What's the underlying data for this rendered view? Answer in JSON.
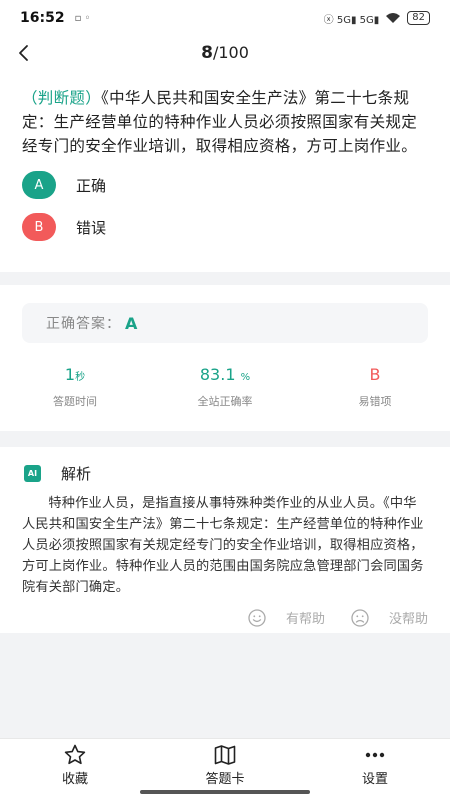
{
  "status_bar": {
    "time": "16:52",
    "notification": "▫ ◦",
    "signal_text": "ⓧ 5G▮ 5G▮",
    "battery": "82"
  },
  "header": {
    "current": "8",
    "total": "/100"
  },
  "question": {
    "type_label": "（判断题）",
    "text": "《中华人民共和国安全生产法》第二十七条规定：生产经营单位的特种作业人员必须按照国家有关规定经专门的安全作业培训，取得相应资格，方可上岗作业。",
    "options": [
      {
        "letter": "A",
        "text": "正确",
        "color": "#1aa389"
      },
      {
        "letter": "B",
        "text": "错误",
        "color": "#f25a5a"
      }
    ]
  },
  "answer": {
    "label": "正确答案：",
    "value": "A"
  },
  "stats": [
    {
      "value": "1",
      "unit": "秒",
      "label": "答题时间"
    },
    {
      "value": "83.1",
      "unit": "%",
      "label": "全站正确率"
    },
    {
      "value": "B",
      "unit": "",
      "label": "易错项"
    }
  ],
  "analysis": {
    "icon_text": "AI",
    "title": "解析",
    "text": "特种作业人员，是指直接从事特殊种类作业的从业人员。《中华人民共和国安全生产法》第二十七条规定：生产经营单位的特种作业人员必须按照国家有关规定经专门的安全作业培训，取得相应资格，方可上岗作业。特种作业人员的范围由国务院应急管理部门会同国务院有关部门确定。",
    "helpful": "有帮助",
    "not_helpful": "没帮助"
  },
  "bottom_tabs": [
    {
      "label": "收藏",
      "icon": "star-icon"
    },
    {
      "label": "答题卡",
      "icon": "map-icon"
    },
    {
      "label": "设置",
      "icon": "more-icon"
    }
  ],
  "colors": {
    "accent": "#1aa389",
    "error": "#f25a5a"
  }
}
